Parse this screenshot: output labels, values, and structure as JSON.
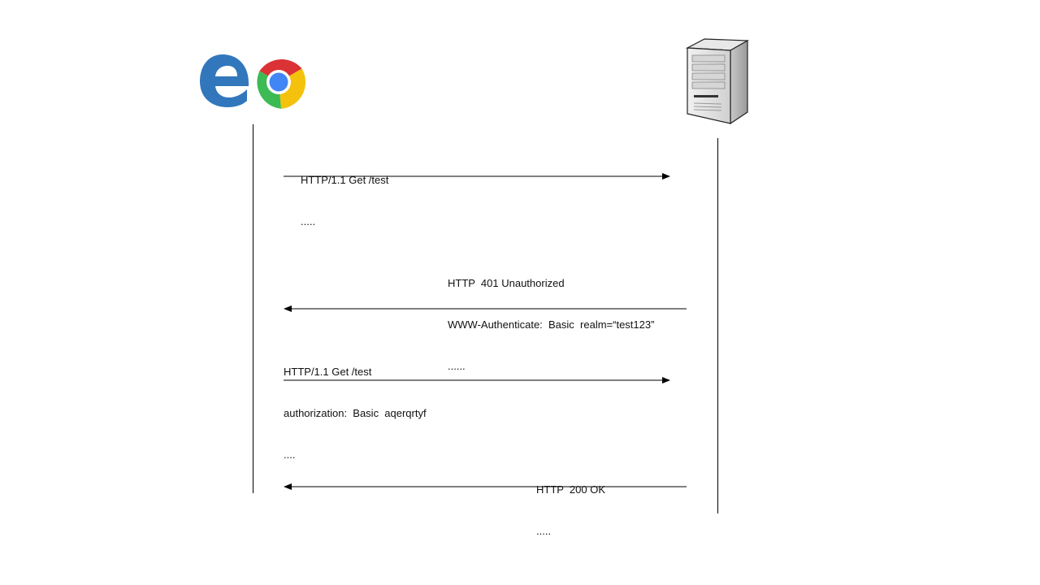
{
  "participants": {
    "client": {
      "icons": [
        "edge-browser-icon",
        "chrome-browser-icon"
      ],
      "edge_color": "#3277bc",
      "chrome_colors": {
        "red": "#db3236",
        "green": "#3cba54",
        "yellow": "#f4c20d",
        "blue": "#4285f4"
      }
    },
    "server": {
      "icon": "server-tower-icon",
      "body_color": "#d9d9d9"
    }
  },
  "messages": [
    {
      "direction": "client-to-server",
      "lines": [
        "HTTP/1.1 Get /test",
        "....."
      ]
    },
    {
      "direction": "server-to-client",
      "lines": [
        "HTTP  401 Unauthorized",
        "WWW-Authenticate:  Basic  realm=“test123”",
        "......"
      ]
    },
    {
      "direction": "client-to-server",
      "lines": [
        "HTTP/1.1 Get /test",
        "authorization:  Basic  aqerqrtyf",
        "...."
      ]
    },
    {
      "direction": "server-to-client",
      "lines": [
        "HTTP  200 OK",
        "....."
      ]
    }
  ]
}
